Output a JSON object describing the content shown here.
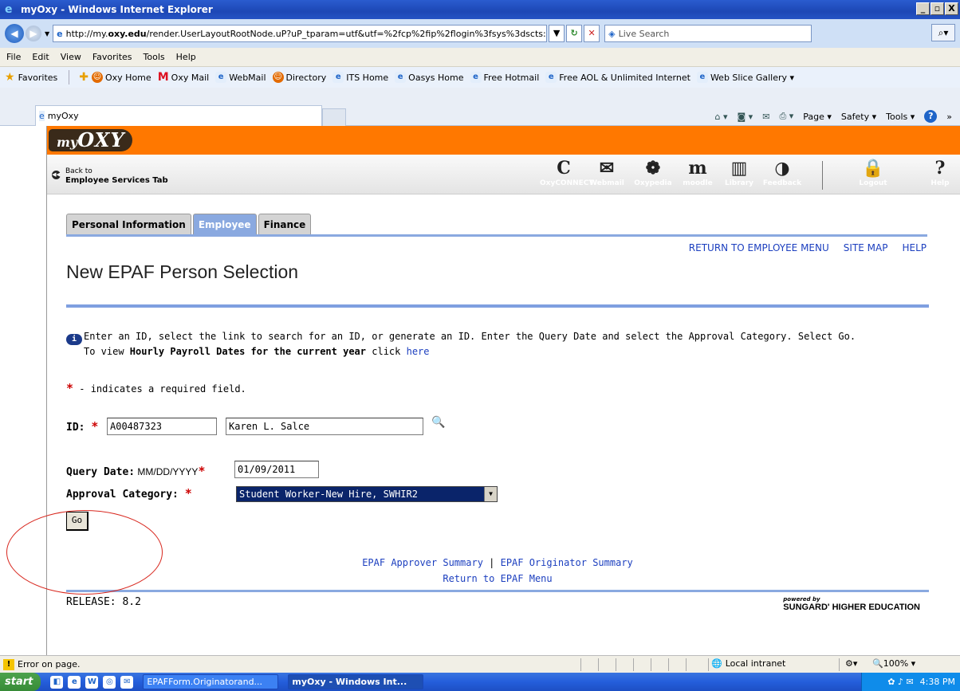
{
  "window": {
    "title": "myOxy - Windows Internet Explorer",
    "controls": [
      "_",
      "▫",
      "X"
    ]
  },
  "address": {
    "url_prefix": "http://my.",
    "url_domain": "oxy.edu",
    "url_rest": "/render.UserLayoutRootNode.uP?uP_tparam=utf&utf=%2fcp%2fip%2flogin%3fsys%3dscts:",
    "search_placeholder": "Live Search"
  },
  "menubar": [
    "File",
    "Edit",
    "View",
    "Favorites",
    "Tools",
    "Help"
  ],
  "favorites": {
    "label": "Favorites",
    "items": [
      {
        "label": "Oxy Home",
        "icon": "oxy-icon"
      },
      {
        "label": "Oxy Mail",
        "icon": "mail-icon"
      },
      {
        "label": "WebMail",
        "icon": "ie-icon"
      },
      {
        "label": "Directory",
        "icon": "oxy-icon"
      },
      {
        "label": "ITS Home",
        "icon": "ie-icon"
      },
      {
        "label": "Oasys Home",
        "icon": "ie-icon"
      },
      {
        "label": "Free Hotmail",
        "icon": "ie-icon"
      },
      {
        "label": "Free AOL & Unlimited Internet",
        "icon": "ie-icon"
      },
      {
        "label": "Web Slice Gallery ▾",
        "icon": "ie-icon"
      }
    ]
  },
  "tabbar": {
    "tab_label": "myOxy",
    "commands": [
      "Page ▾",
      "Safety ▾",
      "Tools ▾"
    ]
  },
  "portal": {
    "logo_prefix": "my",
    "logo_main": "OXY",
    "back_line1": "Back to",
    "back_line2": "Employee Services Tab",
    "apps": [
      {
        "glyph": "C",
        "label": "OxyCONNECT"
      },
      {
        "glyph": "✉",
        "label": "Webmail"
      },
      {
        "glyph": "❁",
        "label": "Oxypedia"
      },
      {
        "glyph": "m",
        "label": "moodle"
      },
      {
        "glyph": "▥",
        "label": "Library"
      },
      {
        "glyph": "◑",
        "label": "Feedback"
      },
      {
        "glyph": "🔒",
        "label": "Logout"
      },
      {
        "glyph": "?",
        "label": "Help"
      }
    ]
  },
  "nav_tabs": [
    "Personal Information",
    "Employee",
    "Finance"
  ],
  "top_links": [
    "RETURN TO EMPLOYEE MENU",
    "SITE MAP",
    "HELP"
  ],
  "page_title": "New EPAF Person Selection",
  "info": {
    "line1": "Enter an ID, select the link to search for an ID, or generate an ID. Enter the Query Date and select the Approval Category. Select Go.",
    "line2_prefix": "To view ",
    "line2_bold": "Hourly Payroll Dates for the current year",
    "line2_mid": " click ",
    "line2_link": "here"
  },
  "required_note": " - indicates a required field.",
  "form": {
    "id_label": "ID:",
    "id_value": "A00487323",
    "name_value": "Karen L. Salce",
    "query_label": "Query Date:",
    "query_format": " MM/DD/YYYY",
    "query_value": "01/09/2011",
    "approval_label": "Approval Category:",
    "approval_value": "Student Worker-New Hire, SWHIR2",
    "go_label": "Go"
  },
  "bottom_links": {
    "approver": "EPAF Approver Summary",
    "separator": " | ",
    "originator": "EPAF Originator Summary",
    "return": "Return to EPAF Menu"
  },
  "release": "RELEASE: 8.2",
  "powered_by": {
    "line1": "powered by",
    "line2": "SUNGARD' HIGHER EDUCATION"
  },
  "statusbar": {
    "message": "Error on page.",
    "zone": "Local intranet",
    "zoom": "100%"
  },
  "taskbar": {
    "start": "start",
    "items": [
      "EPAFForm.Originatorand...",
      "myOxy - Windows Int..."
    ],
    "time": "4:38 PM"
  }
}
